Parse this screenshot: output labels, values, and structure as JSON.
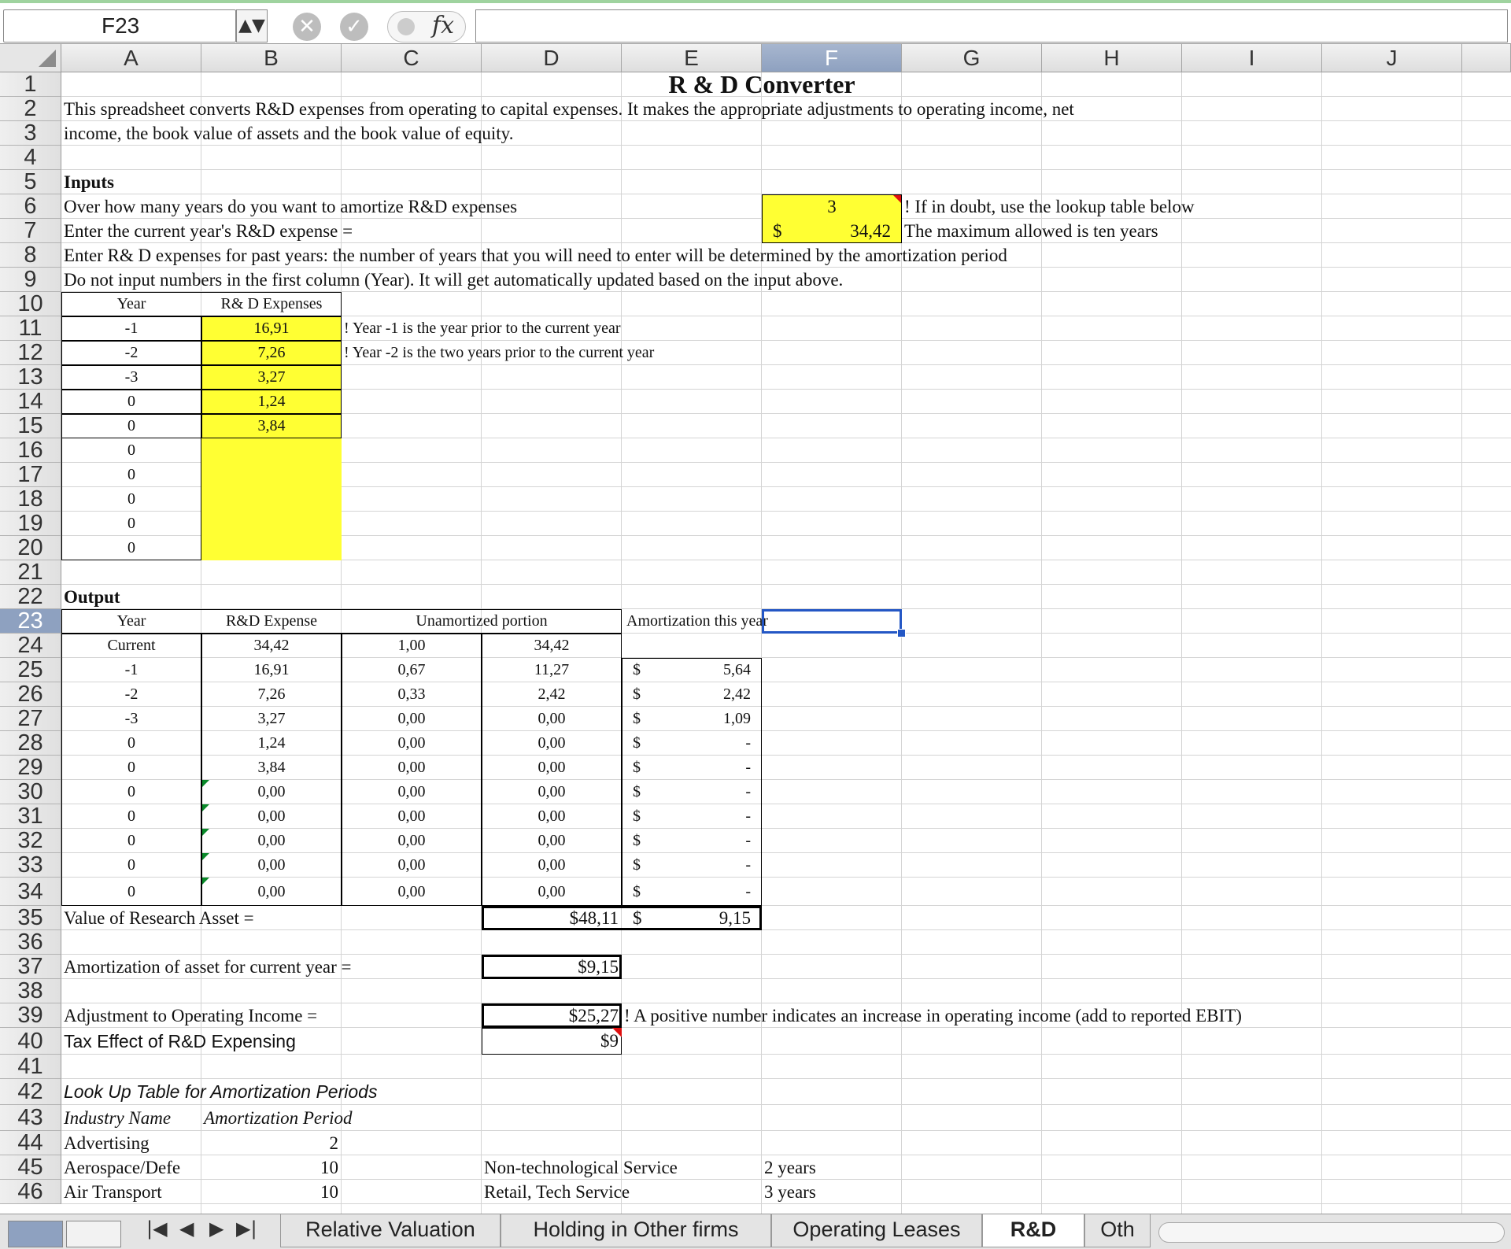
{
  "formula_bar": {
    "name_box": "F23",
    "stepper": "▲▼",
    "cancel": "✕",
    "confirm": "✓",
    "fx": "fx",
    "formula": ""
  },
  "columns": [
    "A",
    "B",
    "C",
    "D",
    "E",
    "F",
    "G",
    "H",
    "I",
    "J"
  ],
  "selected_column": "F",
  "selected_row": "23",
  "cells": {
    "title": "R & D Converter",
    "desc_1": "This spreadsheet converts R&D expenses from operating to capital expenses. It makes the appropriate adjustments to operating income, net",
    "desc_2": "income, the book value of assets and the book value of equity.",
    "inputs_header": "Inputs",
    "q_years": "Over how many years do you want to amortize R&D expenses",
    "amort_years": "3",
    "note_lookup": "! If in doubt, use the lookup table below",
    "q_current": "Enter the current year's R&D expense =",
    "dollar": "$",
    "current_rd": "34,42",
    "note_max": "The maximum allowed is ten years",
    "q_past": "Enter R& D expenses for past years: the number of years that you will need to enter will be determined by the amortization period",
    "q_note": "Do not input numbers in the first column (Year). It will get automatically updated  based on the input above.",
    "input_year_header": "Year",
    "input_exp_header": "R& D Expenses",
    "note_y1": "! Year -1 is the year prior to the current year",
    "note_y2": "! Year -2 is the two years prior to the current year",
    "output_header": "Output",
    "out_year": "Year",
    "out_expense": "R&D Expense",
    "out_unamort": "Unamortized portion",
    "out_amort": "Amortization this year",
    "value_label": "Value of Research Asset =",
    "value_total": "$48,11",
    "amort_total": "9,15",
    "amort_label": "Amortization of asset for current year =",
    "amort_value": "$9,15",
    "adj_label": "Adjustment to Operating Income =",
    "adj_value": "$25,27",
    "adj_note": "! A positive number indicates an increase in operating income (add to reported EBIT)",
    "tax_label": "Tax Effect of R&D Expensing",
    "tax_value": "$9",
    "lookup_title": "Look Up Table for Amortization Periods",
    "lookup_col1": "Industry Name",
    "lookup_col2": "Amortization Period"
  },
  "input_rows": [
    {
      "year": "-1",
      "exp": "16,91"
    },
    {
      "year": "-2",
      "exp": "7,26"
    },
    {
      "year": "-3",
      "exp": "3,27"
    },
    {
      "year": "0",
      "exp": "1,24"
    },
    {
      "year": "0",
      "exp": "3,84"
    },
    {
      "year": "0",
      "exp": ""
    },
    {
      "year": "0",
      "exp": ""
    },
    {
      "year": "0",
      "exp": ""
    },
    {
      "year": "0",
      "exp": ""
    },
    {
      "year": "0",
      "exp": ""
    }
  ],
  "output_rows": [
    {
      "year": "Current",
      "exp": "34,42",
      "pct": "1,00",
      "unamort": "34,42",
      "d": "",
      "amort": ""
    },
    {
      "year": "-1",
      "exp": "16,91",
      "pct": "0,67",
      "unamort": "11,27",
      "d": "$",
      "amort": "5,64"
    },
    {
      "year": "-2",
      "exp": "7,26",
      "pct": "0,33",
      "unamort": "2,42",
      "d": "$",
      "amort": "2,42"
    },
    {
      "year": "-3",
      "exp": "3,27",
      "pct": "0,00",
      "unamort": "0,00",
      "d": "$",
      "amort": "1,09"
    },
    {
      "year": "0",
      "exp": "1,24",
      "pct": "0,00",
      "unamort": "0,00",
      "d": "$",
      "amort": "-"
    },
    {
      "year": "0",
      "exp": "3,84",
      "pct": "0,00",
      "unamort": "0,00",
      "d": "$",
      "amort": "-"
    },
    {
      "year": "0",
      "exp": "0,00",
      "pct": "0,00",
      "unamort": "0,00",
      "d": "$",
      "amort": "-"
    },
    {
      "year": "0",
      "exp": "0,00",
      "pct": "0,00",
      "unamort": "0,00",
      "d": "$",
      "amort": "-"
    },
    {
      "year": "0",
      "exp": "0,00",
      "pct": "0,00",
      "unamort": "0,00",
      "d": "$",
      "amort": "-"
    },
    {
      "year": "0",
      "exp": "0,00",
      "pct": "0,00",
      "unamort": "0,00",
      "d": "$",
      "amort": "-"
    },
    {
      "year": "0",
      "exp": "0,00",
      "pct": "0,00",
      "unamort": "0,00",
      "d": "$",
      "amort": "-"
    }
  ],
  "lookup_rows": [
    {
      "industry": "Advertising",
      "period": "2",
      "svc": "",
      "svc_period": ""
    },
    {
      "industry": "Aerospace/Defe",
      "period": "10",
      "svc": "Non-technological Service",
      "svc_period": "2 years"
    },
    {
      "industry": "Air Transport",
      "period": "10",
      "svc": "Retail, Tech Service",
      "svc_period": "3 years"
    }
  ],
  "tabs": {
    "nav": [
      "|◀",
      "◀",
      "▶",
      "▶|"
    ],
    "items": [
      "Relative Valuation",
      "Holding in Other firms",
      "Operating Leases",
      "R&D",
      "Oth"
    ],
    "active": "R&D"
  }
}
